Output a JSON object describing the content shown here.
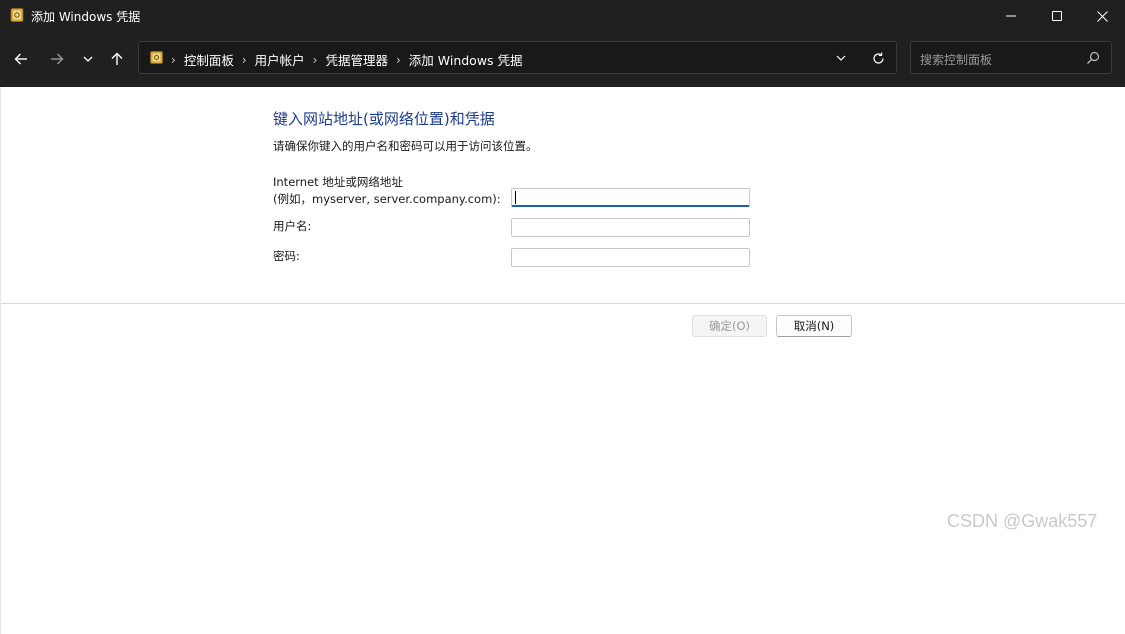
{
  "window": {
    "title": "添加 Windows 凭据",
    "app_icon": "credential-manager-icon"
  },
  "titlebar_buttons": {
    "minimize_icon": "minimize-icon",
    "maximize_icon": "maximize-icon",
    "close_icon": "close-icon"
  },
  "nav": {
    "back_icon": "arrow-left-icon",
    "forward_icon": "arrow-right-icon",
    "recent_icon": "chevron-down-icon",
    "up_icon": "arrow-up-icon"
  },
  "address_bar": {
    "icon": "control-panel-icon",
    "breadcrumbs": [
      "控制面板",
      "用户帐户",
      "凭据管理器",
      "添加 Windows 凭据"
    ],
    "separator": "›",
    "dropdown_icon": "chevron-down-icon",
    "refresh_icon": "refresh-icon"
  },
  "search": {
    "placeholder": "搜索控制面板",
    "icon": "search-icon"
  },
  "form": {
    "heading": "键入网站地址(或网络位置)和凭据",
    "description": "请确保你键入的用户名和密码可以用于访问该位置。",
    "address_label_line1": "Internet 地址或网络地址",
    "address_label_line2": "(例如，myserver, server.company.com):",
    "address_value": "",
    "username_label": "用户名:",
    "username_value": "",
    "password_label": "密码:",
    "password_value": ""
  },
  "buttons": {
    "ok_label": "确定(O)",
    "cancel_label": "取消(N)"
  },
  "watermark": "CSDN @Gwak557",
  "colors": {
    "titlebar_bg": "#202020",
    "heading_color": "#1e3c8c",
    "focus_underline": "#1a5fb4"
  }
}
